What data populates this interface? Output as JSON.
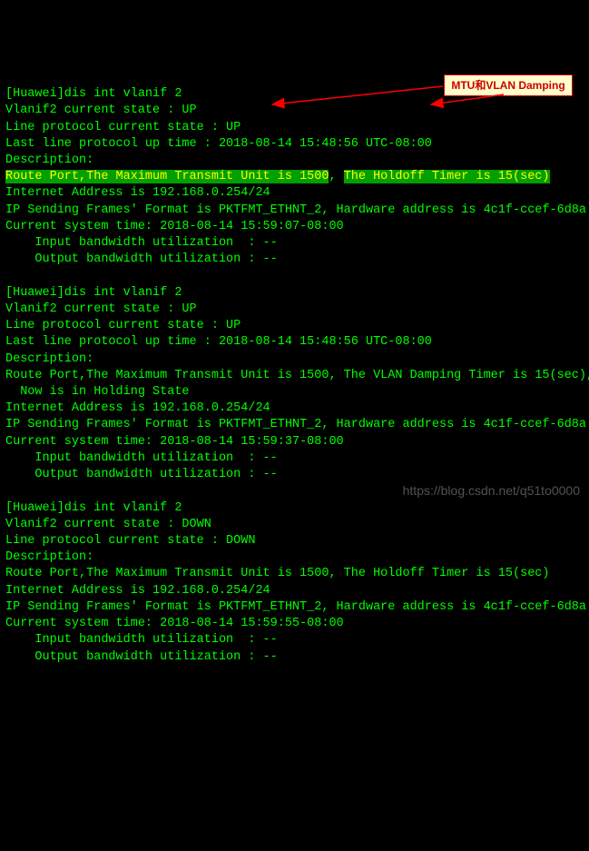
{
  "block1": {
    "l1": "[Huawei]dis int vlanif 2",
    "l2": "Vlanif2 current state : UP",
    "l3": "Line protocol current state : UP",
    "l4": "Last line protocol up time : 2018-08-14 15:48:56 UTC-08:00",
    "l5": "Description:",
    "hl_a": "Route Port,",
    "hl_b": "The Maximum Transmit Unit is 1500",
    "comma": ", ",
    "hl_c": "The Holdoff Timer is 15(sec)",
    "l7": "Internet Address is 192.168.0.254/24",
    "l8": "IP Sending Frames' Format is PKTFMT_ETHNT_2, Hardware address is 4c1f-ccef-6d8a",
    "l9": "Current system time: 2018-08-14 15:59:07-08:00",
    "l10": "    Input bandwidth utilization  : --",
    "l11": "    Output bandwidth utilization : --"
  },
  "block2": {
    "l1": "[Huawei]dis int vlanif 2",
    "l2": "Vlanif2 current state : UP",
    "l3": "Line protocol current state : UP",
    "l4": "Last line protocol up time : 2018-08-14 15:48:56 UTC-08:00",
    "l5": "Description:",
    "l6": "Route Port,The Maximum Transmit Unit is 1500, The VLAN Damping Timer is 15(sec),",
    "l6b": "  Now is in Holding State",
    "l7": "Internet Address is 192.168.0.254/24",
    "l8": "IP Sending Frames' Format is PKTFMT_ETHNT_2, Hardware address is 4c1f-ccef-6d8a",
    "l9": "Current system time: 2018-08-14 15:59:37-08:00",
    "l10": "    Input bandwidth utilization  : --",
    "l11": "    Output bandwidth utilization : --"
  },
  "block3": {
    "l1": "[Huawei]dis int vlanif 2",
    "l2": "Vlanif2 current state : DOWN",
    "l3": "Line protocol current state : DOWN",
    "l4": "Description:",
    "l5": "Route Port,The Maximum Transmit Unit is 1500, The Holdoff Timer is 15(sec)",
    "l6": "Internet Address is 192.168.0.254/24",
    "l7": "IP Sending Frames' Format is PKTFMT_ETHNT_2, Hardware address is 4c1f-ccef-6d8a",
    "l8": "Current system time: 2018-08-14 15:59:55-08:00",
    "l9": "    Input bandwidth utilization  : --",
    "l10": "    Output bandwidth utilization : --"
  },
  "callout": "MTU和VLAN Damping",
  "watermark": "https://blog.csdn.net/q51to0000"
}
